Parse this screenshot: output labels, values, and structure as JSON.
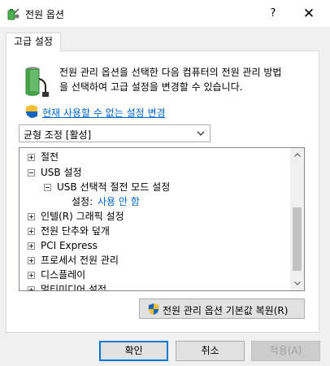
{
  "window": {
    "title": "전원 옵션",
    "help_glyph": "?",
    "close_glyph": "✕"
  },
  "tab": {
    "label": "고급 설정"
  },
  "description": {
    "line1": "전원 관리 옵션을 선택한 다음 컴퓨터의 전원 관리 방법",
    "line2": "을 선택하여 고급 설정을 변경할 수 있습니다."
  },
  "change_link": "현재 사용할 수 없는 설정 변경",
  "plan_select": {
    "value": "균형 조정 [활성]"
  },
  "tree": {
    "items": [
      {
        "label": "절전",
        "state": "collapsed"
      },
      {
        "label": "USB 설정",
        "state": "expanded"
      },
      {
        "label": "USB 선택적 절전 모드 설정",
        "state": "expanded"
      },
      {
        "label": "설정:",
        "value": "사용 안 함"
      },
      {
        "label": "인텔(R) 그래픽 설정",
        "state": "collapsed"
      },
      {
        "label": "전원 단추와 덮개",
        "state": "collapsed"
      },
      {
        "label": "PCI Express",
        "state": "collapsed"
      },
      {
        "label": "프로세서 전원 관리",
        "state": "collapsed"
      },
      {
        "label": "디스플레이",
        "state": "collapsed"
      },
      {
        "label": "멀티미디어 설정",
        "state": "collapsed"
      }
    ]
  },
  "buttons": {
    "restore": "전원 관리 옵션 기본값 복원(R)",
    "ok": "확인",
    "cancel": "취소",
    "apply": "적용(A)"
  },
  "colors": {
    "link": "#0066cc",
    "default_button_border": "#0078d7",
    "panel_background": "#ffffff",
    "window_background": "#f0f0f0"
  }
}
